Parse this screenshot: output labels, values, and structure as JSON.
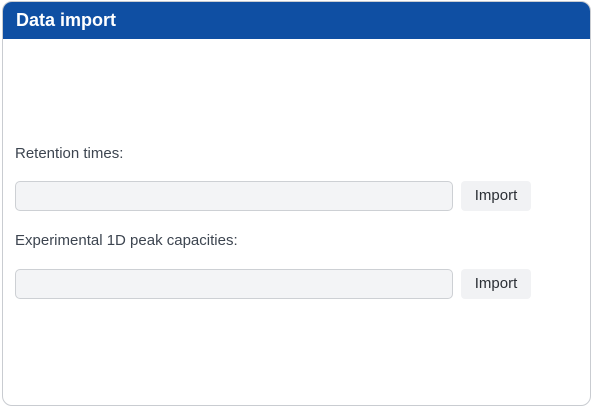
{
  "panel": {
    "title": "Data import"
  },
  "retention_times": {
    "label": "Retention times:",
    "value": "",
    "button_label": "Import"
  },
  "peak_capacities": {
    "label": "Experimental 1D peak capacities:",
    "value": "",
    "button_label": "Import"
  },
  "colors": {
    "header_background": "#0f4fa3",
    "header_text": "#ffffff",
    "input_background": "#f3f4f6",
    "button_background": "#f1f2f4"
  }
}
